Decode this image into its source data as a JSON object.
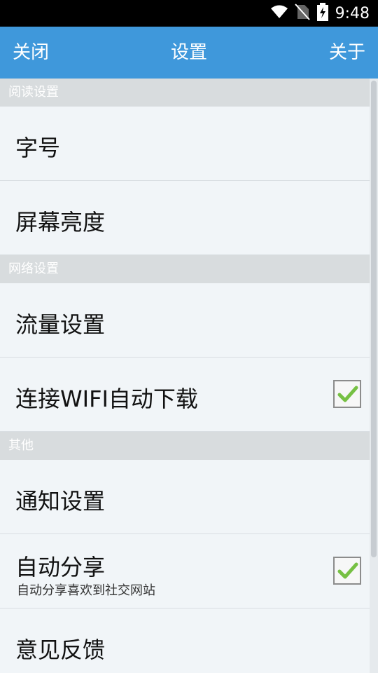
{
  "status_bar": {
    "time": "9:48",
    "icons": [
      "wifi-icon",
      "no-sim-icon",
      "battery-charging-icon"
    ]
  },
  "top_bar": {
    "close_label": "关闭",
    "title": "设置",
    "about_label": "关于"
  },
  "sections": [
    {
      "header": "阅读设置",
      "items": [
        {
          "label": "字号"
        },
        {
          "label": "屏幕亮度"
        }
      ]
    },
    {
      "header": "网络设置",
      "items": [
        {
          "label": "流量设置"
        },
        {
          "label": "连接WIFI自动下载",
          "checked": true
        }
      ]
    },
    {
      "header": "其他",
      "items": [
        {
          "label": "通知设置"
        },
        {
          "label": "自动分享",
          "subtitle": "自动分享喜欢到社交网站",
          "checked": true
        },
        {
          "label": "意见反馈"
        }
      ]
    }
  ],
  "colors": {
    "accent": "#3f98db",
    "section_header": "#d8dcde",
    "check_green": "#76c043"
  }
}
